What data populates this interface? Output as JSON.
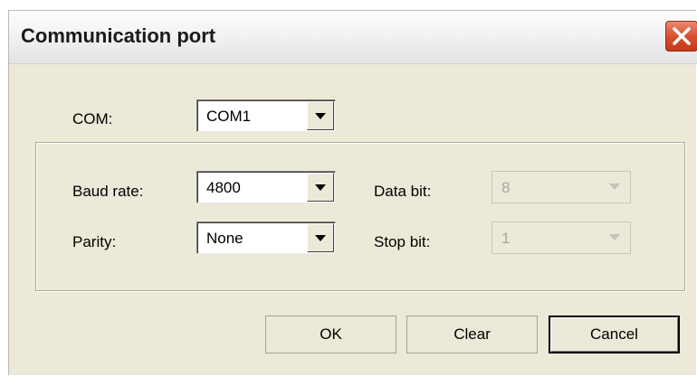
{
  "dialog": {
    "title": "Communication port",
    "close_icon": "close-x-icon"
  },
  "com": {
    "label": "COM:",
    "value": "COM1"
  },
  "settings": {
    "baud_rate": {
      "label": "Baud rate:",
      "value": "4800",
      "enabled": true
    },
    "parity": {
      "label": "Parity:",
      "value": "None",
      "enabled": true
    },
    "data_bit": {
      "label": "Data bit:",
      "value": "8",
      "enabled": false
    },
    "stop_bit": {
      "label": "Stop bit:",
      "value": "1",
      "enabled": false
    }
  },
  "buttons": {
    "ok": "OK",
    "clear": "Clear",
    "cancel": "Cancel"
  },
  "colors": {
    "dialog_bg": "#ece9d8",
    "close_button": "#d9512f"
  }
}
